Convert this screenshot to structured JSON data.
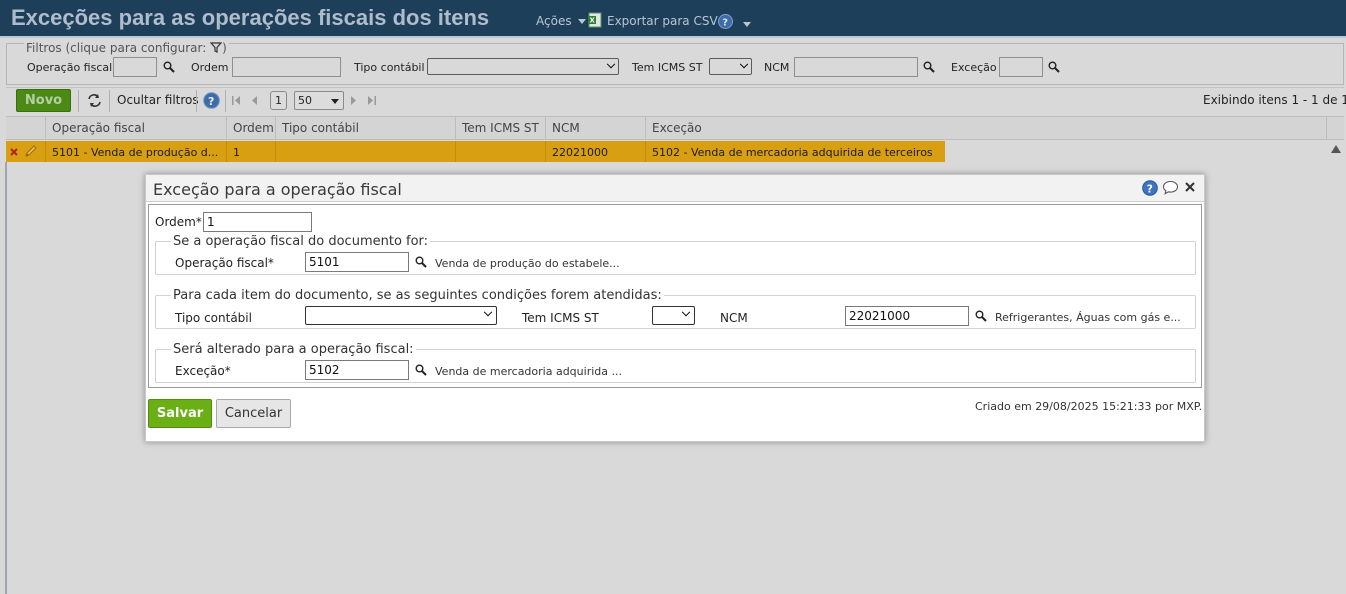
{
  "header": {
    "title": "Exceções para as operações fiscais dos itens",
    "actions_label": "Ações",
    "export_label": "Exportar para CSV"
  },
  "filters": {
    "legend": "Filtros (clique para configurar:",
    "legend_close": ")",
    "operacao_fiscal_label": "Operação fiscal",
    "ordem_label": "Ordem",
    "tipo_contabil_label": "Tipo contábil",
    "tem_icms_st_label": "Tem ICMS ST",
    "ncm_label": "NCM",
    "excecao_label": "Exceção"
  },
  "toolbar": {
    "novo_label": "Novo",
    "ocultar_filtros_label": "Ocultar filtros",
    "page": "1",
    "page_size": "50",
    "exibindo": "Exibindo itens 1 - 1 de 1"
  },
  "grid": {
    "columns": [
      "Operação fiscal",
      "Ordem",
      "Tipo contábil",
      "Tem ICMS ST",
      "NCM",
      "Exceção"
    ],
    "rows": [
      {
        "operacao_fiscal": "5101 - Venda de produção d...",
        "ordem": "1",
        "tipo_contabil": "",
        "tem_icms_st": "",
        "ncm": "22021000",
        "excecao": "5102 - Venda de mercadoria adquirida de terceiros"
      }
    ]
  },
  "modal": {
    "title": "Exceção para a operação fiscal",
    "ordem_label": "Ordem*",
    "ordem_value": "1",
    "group1_legend": "Se a operação fiscal do documento for:",
    "operacao_fiscal_label": "Operação fiscal*",
    "operacao_fiscal_value": "5101",
    "operacao_fiscal_desc": "Venda de produção do estabele...",
    "group2_legend": "Para cada item do documento, se as seguintes condições forem atendidas:",
    "tipo_contabil_label": "Tipo contábil",
    "tipo_contabil_value": "",
    "tem_icms_st_label": "Tem ICMS ST",
    "tem_icms_st_value": "",
    "ncm_label": "NCM",
    "ncm_value": "22021000",
    "ncm_desc": "Refrigerantes, Águas com gás e...",
    "group3_legend": "Será alterado para a operação fiscal:",
    "excecao_label": "Exceção*",
    "excecao_value": "5102",
    "excecao_desc": "Venda de mercadoria adquirida ...",
    "salvar_label": "Salvar",
    "cancelar_label": "Cancelar",
    "created_text": "Criado em 29/08/2025 15:21:33 por MXP."
  },
  "colors": {
    "header_bg": "#1e3f5a",
    "selected_row": "#d89f12",
    "save_button": "#6ab014",
    "novo_button": "#4b8a14"
  }
}
